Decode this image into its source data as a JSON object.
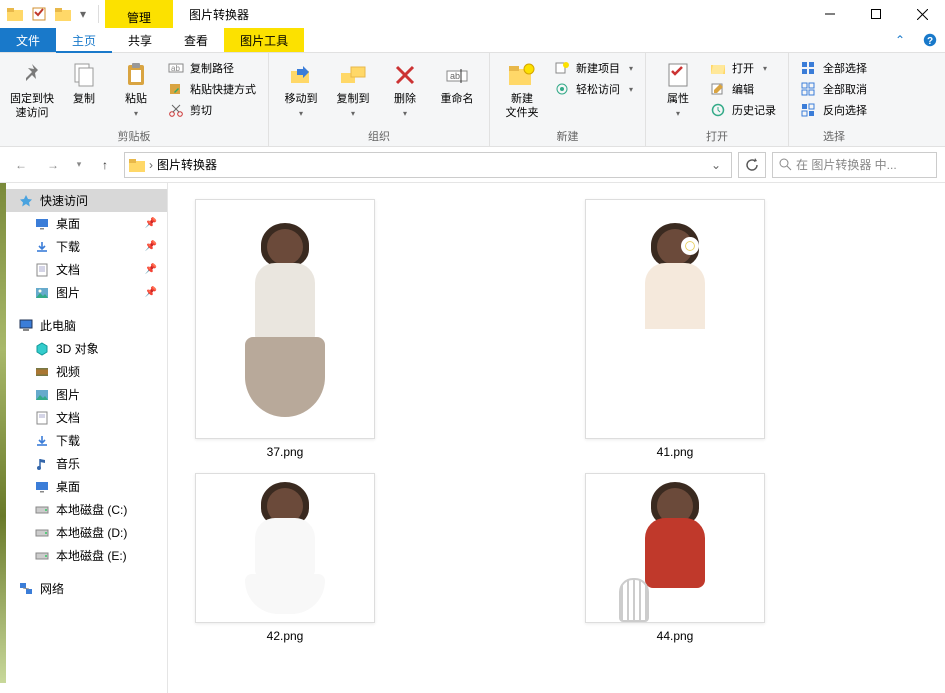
{
  "window": {
    "title": "图片转换器",
    "context_tab_group": "管理",
    "context_tab": "图片工具"
  },
  "tabs": {
    "file": "文件",
    "home": "主页",
    "share": "共享",
    "view": "查看"
  },
  "ribbon": {
    "clipboard": {
      "pin": "固定到快\n速访问",
      "copy": "复制",
      "paste": "粘贴",
      "copy_path": "复制路径",
      "paste_shortcut": "粘贴快捷方式",
      "cut": "剪切",
      "group": "剪贴板"
    },
    "organize": {
      "move_to": "移动到",
      "copy_to": "复制到",
      "delete": "删除",
      "rename": "重命名",
      "group": "组织"
    },
    "new": {
      "new_folder": "新建\n文件夹",
      "new_item": "新建项目",
      "easy_access": "轻松访问",
      "group": "新建"
    },
    "open": {
      "properties": "属性",
      "open": "打开",
      "edit": "编辑",
      "history": "历史记录",
      "group": "打开"
    },
    "select": {
      "select_all": "全部选择",
      "select_none": "全部取消",
      "invert": "反向选择",
      "group": "选择"
    }
  },
  "address": {
    "folder": "图片转换器"
  },
  "search": {
    "placeholder": "在 图片转换器 中..."
  },
  "sidebar": {
    "quick_access": "快速访问",
    "desktop": "桌面",
    "downloads": "下载",
    "documents": "文档",
    "pictures": "图片",
    "this_pc": "此电脑",
    "objects3d": "3D 对象",
    "videos": "视频",
    "pictures2": "图片",
    "documents2": "文档",
    "downloads2": "下载",
    "music": "音乐",
    "desktop2": "桌面",
    "drive_c": "本地磁盘 (C:)",
    "drive_d": "本地磁盘 (D:)",
    "drive_e": "本地磁盘 (E:)",
    "network": "网络"
  },
  "files": {
    "f1": "37.png",
    "f2": "41.png",
    "f3": "42.png",
    "f4": "44.png"
  }
}
